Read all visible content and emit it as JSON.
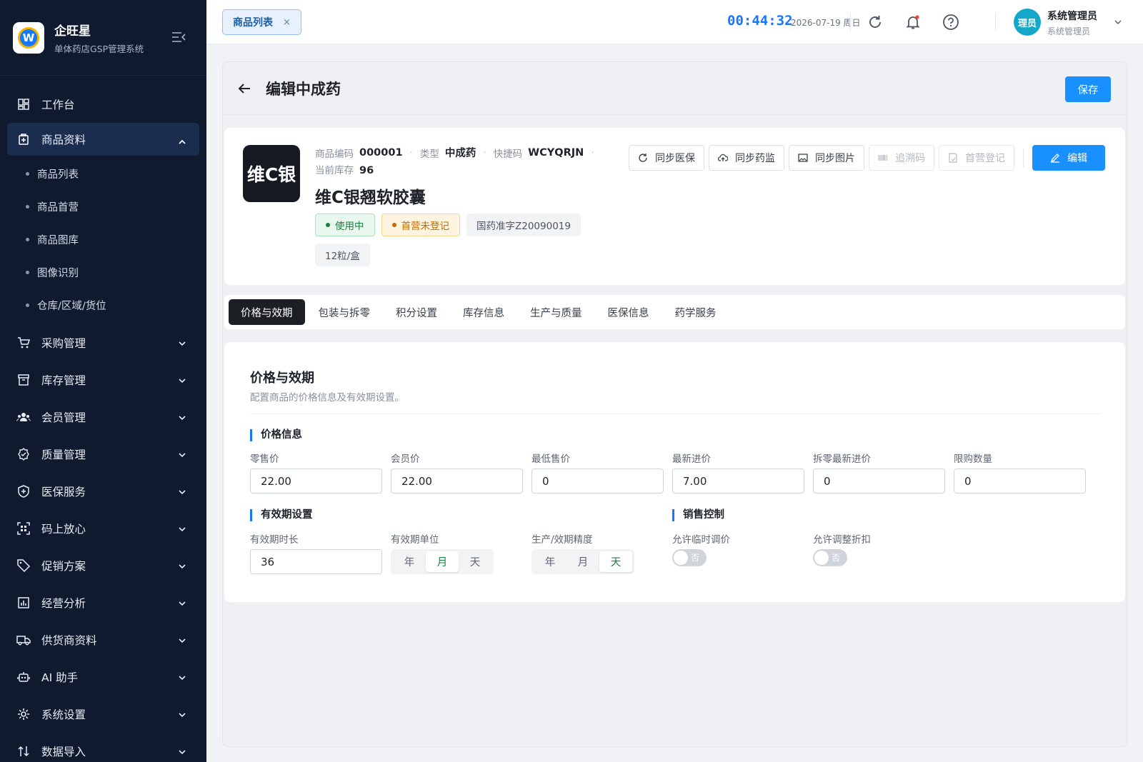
{
  "brand": {
    "name": "企旺星",
    "subtitle": "单体药店GSP管理系统",
    "logo_letter": "W"
  },
  "sidebar": {
    "items": [
      {
        "label": "工作台",
        "icon": "dashboard-icon"
      },
      {
        "label": "商品资料",
        "icon": "product-icon",
        "expanded": true,
        "children": [
          "商品列表",
          "商品首营",
          "商品图库",
          "图像识别",
          "仓库/区域/货位"
        ]
      },
      {
        "label": "采购管理",
        "icon": "cart-icon"
      },
      {
        "label": "库存管理",
        "icon": "inventory-icon"
      },
      {
        "label": "会员管理",
        "icon": "members-icon"
      },
      {
        "label": "质量管理",
        "icon": "quality-icon"
      },
      {
        "label": "医保服务",
        "icon": "shield-icon"
      },
      {
        "label": "码上放心",
        "icon": "scan-icon"
      },
      {
        "label": "促销方案",
        "icon": "tag-icon"
      },
      {
        "label": "经营分析",
        "icon": "chart-icon"
      },
      {
        "label": "供货商资料",
        "icon": "truck-icon"
      },
      {
        "label": "AI 助手",
        "icon": "robot-icon"
      },
      {
        "label": "系统设置",
        "icon": "gear-icon"
      },
      {
        "label": "数据导入",
        "icon": "import-icon"
      }
    ]
  },
  "topbar": {
    "open_tab": "商品列表",
    "close_symbol": "×",
    "clock": "00:44:32",
    "date": "2026-07-19 周日",
    "user": {
      "avatar_text": "理员",
      "name": "系统管理员",
      "role": "系统管理员"
    }
  },
  "page": {
    "title": "编辑中成药",
    "save_label": "保存"
  },
  "product": {
    "logo_text": "维C银",
    "code_label": "商品编码",
    "code": "000001",
    "type_label": "类型",
    "type": "中成药",
    "shortcode_label": "快捷码",
    "shortcode": "WCYQRJN",
    "stock_label": "当前库存",
    "stock": "96",
    "name": "维C银翘软胶囊",
    "status_badge": "使用中",
    "first_reg_badge": "首营未登记",
    "approval_no": "国药准字Z20090019",
    "spec": "12粒/盒"
  },
  "actions": [
    {
      "label": "同步医保",
      "icon": "sync-icon",
      "enabled": true
    },
    {
      "label": "同步药监",
      "icon": "cloud-upload-icon",
      "enabled": true
    },
    {
      "label": "同步图片",
      "icon": "image-icon",
      "enabled": true
    },
    {
      "label": "追溯码",
      "icon": "barcode-icon",
      "enabled": false
    },
    {
      "label": "首营登记",
      "icon": "register-icon",
      "enabled": false
    }
  ],
  "edit_label": "编辑",
  "tabs": [
    "价格与效期",
    "包装与拆零",
    "积分设置",
    "库存信息",
    "生产与质量",
    "医保信息",
    "药学服务"
  ],
  "active_tab": 0,
  "form": {
    "title": "价格与效期",
    "description": "配置商品的价格信息及有效期设置。",
    "price_group": "价格信息",
    "fields": [
      {
        "label": "零售价",
        "value": "22.00"
      },
      {
        "label": "会员价",
        "value": "22.00"
      },
      {
        "label": "最低售价",
        "value": "0"
      },
      {
        "label": "最新进价",
        "value": "7.00"
      },
      {
        "label": "拆零最新进价",
        "value": "0"
      },
      {
        "label": "限购数量",
        "value": "0"
      }
    ],
    "expiry_group": "有效期设置",
    "expiry_duration_label": "有效期时长",
    "expiry_duration": "36",
    "expiry_unit_label": "有效期单位",
    "expiry_unit_options": [
      "年",
      "月",
      "天"
    ],
    "expiry_unit_selected": "月",
    "precision_label": "生产/效期精度",
    "precision_options": [
      "年",
      "月",
      "天"
    ],
    "precision_selected": "天",
    "sales_group": "销售控制",
    "allow_temp_price_label": "允许临时调价",
    "allow_temp_price": "否",
    "allow_discount_label": "允许调整折扣",
    "allow_discount": "否"
  },
  "colors": {
    "primary": "#1890ff",
    "sidebar_bg": "#0f1a2e",
    "active_tab_bg": "#1c1f24",
    "success": "#16843f",
    "warning": "#c46a00"
  }
}
